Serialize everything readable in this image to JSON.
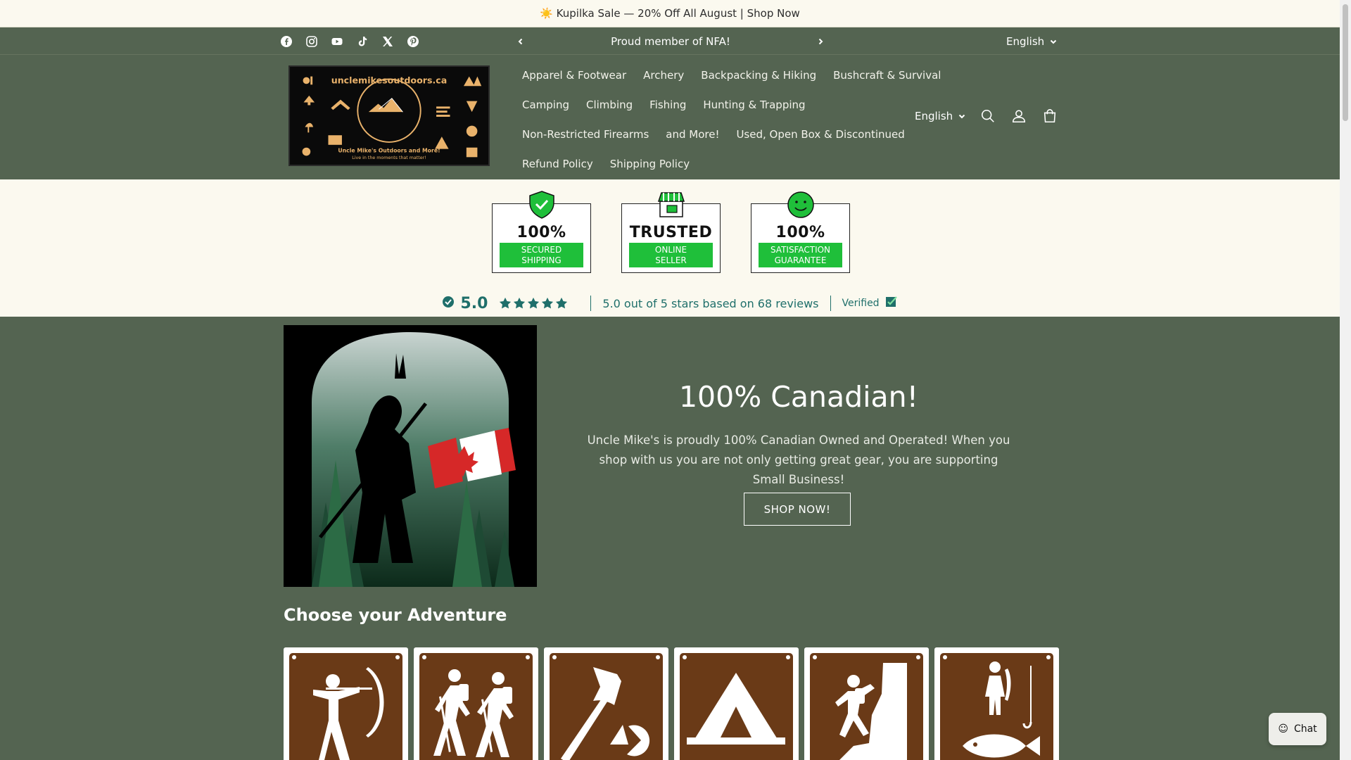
{
  "announcement": {
    "text": "☀️ Kupilka Sale — 20% Off All August | Shop Now"
  },
  "topbar": {
    "socials": [
      "facebook",
      "instagram",
      "youtube",
      "tiktok",
      "x",
      "pinterest"
    ],
    "promo_text": "Proud member of NFA!",
    "language": "English"
  },
  "header": {
    "logo_text": "unclemikesoutdoors.ca",
    "logo_tagline": "Uncle Mike's Outdoors and More!",
    "logo_subtagline": "Live in the moments that matter!",
    "nav": [
      [
        "Apparel & Footwear",
        "Archery",
        "Backpacking & Hiking",
        "Bushcraft & Survival"
      ],
      [
        "Camping",
        "Climbing",
        "Fishing",
        "Hunting & Trapping"
      ],
      [
        "Non-Restricted Firearms",
        "and More!",
        "Used, Open Box & Discontinued"
      ],
      [
        "Refund Policy",
        "Shipping Policy"
      ]
    ],
    "language": "English"
  },
  "trust_badges": [
    {
      "head": "100%",
      "line1": "SECURED",
      "line2": "SHIPPING",
      "icon": "shield-check-icon"
    },
    {
      "head": "TRUSTED",
      "line1": "ONLINE",
      "line2": "SELLER",
      "icon": "storefront-icon"
    },
    {
      "head": "100%",
      "line1": "SATISFACTION",
      "line2": "GUARANTEE",
      "icon": "smiley-icon"
    }
  ],
  "reviews": {
    "score": "5.0",
    "rating": 5,
    "summary": "5.0 out of 5 stars based on 68 reviews",
    "verified": "Verified"
  },
  "hero": {
    "title": "100% Canadian!",
    "text": "Uncle Mike's is proudly 100% Canadian Owned and Operated! When you shop with us you are not only getting great gear, you are supporting Small Business!",
    "button": "SHOP NOW!"
  },
  "adventure": {
    "title": "Choose your Adventure",
    "tiles": [
      "archery-icon",
      "hiking-icon",
      "bushcraft-axe-icon",
      "camping-tent-icon",
      "climbing-icon",
      "fishing-icon"
    ]
  },
  "chat": {
    "label": "Chat"
  },
  "colors": {
    "header_bg": "#546451",
    "announce_bg": "#fbf9ef",
    "badge_green": "#1fbf3a",
    "review_teal": "#1f6f6a",
    "tile_brown": "#6a3a17"
  }
}
